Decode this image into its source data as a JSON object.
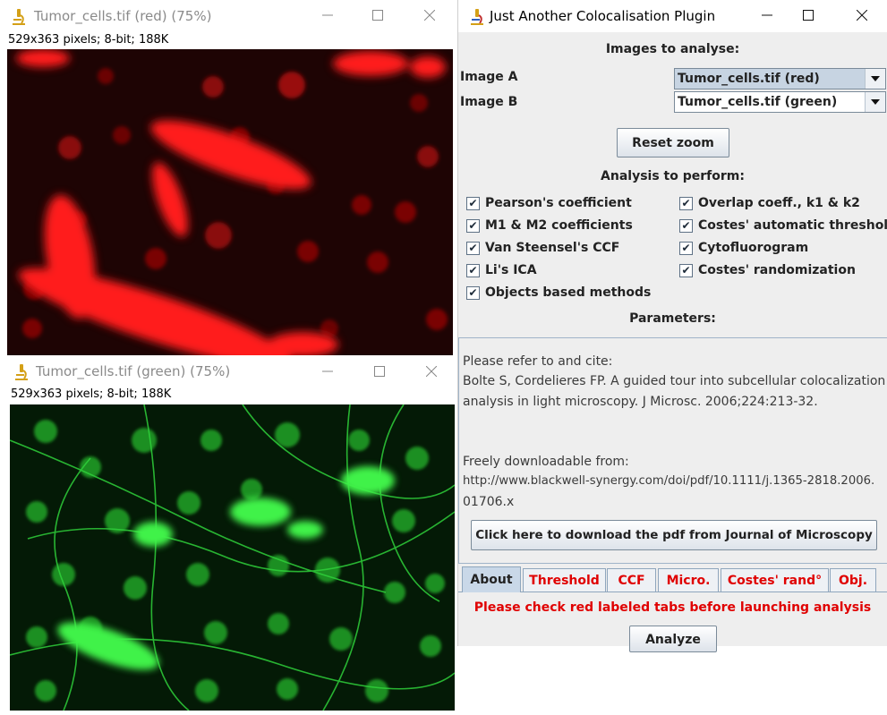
{
  "red_window": {
    "title": "Tumor_cells.tif (red) (75%)",
    "info": "529x363 pixels; 8-bit; 188K",
    "minimize_icon": "minimize-icon",
    "maximize_icon": "maximize-icon",
    "close_icon": "close-icon",
    "app_icon": "microscope-icon",
    "channel_color": "#e00000"
  },
  "green_window": {
    "title": "Tumor_cells.tif (green) (75%)",
    "info": "529x363 pixels; 8-bit; 188K",
    "minimize_icon": "minimize-icon",
    "maximize_icon": "maximize-icon",
    "close_icon": "close-icon",
    "app_icon": "microscope-icon",
    "channel_color": "#18c818"
  },
  "plugin": {
    "title": "Just Another Colocalisation Plugin",
    "images_header": "Images to analyse:",
    "image_a": {
      "label": "Image A",
      "value": "Tumor_cells.tif (red)"
    },
    "image_b": {
      "label": "Image B",
      "value": "Tumor_cells.tif (green)"
    },
    "reset_zoom": "Reset zoom",
    "analysis_header": "Analysis to perform:",
    "analyses": [
      {
        "label": "Pearson's coefficient",
        "checked": true
      },
      {
        "label": "Overlap coeff., k1 & k2",
        "checked": true
      },
      {
        "label": "M1 & M2 coefficients",
        "checked": true
      },
      {
        "label": "Costes' automatic threshold",
        "checked": true
      },
      {
        "label": "Van Steensel's CCF",
        "checked": true
      },
      {
        "label": "Cytofluorogram",
        "checked": true
      },
      {
        "label": "Li's ICA",
        "checked": true
      },
      {
        "label": "Costes' randomization",
        "checked": true
      },
      {
        "label": "Objects based methods",
        "checked": true
      }
    ],
    "parameters_header": "Parameters:",
    "about_text": [
      "Please refer to and cite:",
      "Bolte S, Cordelieres FP. A guided tour into subcellular colocalization",
      "analysis in light microscopy. J Microsc. 2006;224:213-32.",
      "Freely downloadable from:",
      "http://www.blackwell-synergy.com/doi/pdf/10.1111/j.1365-2818.2006.",
      "01706.x"
    ],
    "download_button": "Click here to download the pdf from Journal of Microscopy",
    "tabs": [
      {
        "label": "About",
        "active": true,
        "warning": false
      },
      {
        "label": "Threshold",
        "active": false,
        "warning": true
      },
      {
        "label": "CCF",
        "active": false,
        "warning": true
      },
      {
        "label": "Micro.",
        "active": false,
        "warning": true
      },
      {
        "label": "Costes' rand°",
        "active": false,
        "warning": true
      },
      {
        "label": "Obj.",
        "active": false,
        "warning": true
      }
    ],
    "warning": "Please check red labeled tabs before launching analysis",
    "analyze_button": "Analyze",
    "warning_color": "#e00000"
  }
}
